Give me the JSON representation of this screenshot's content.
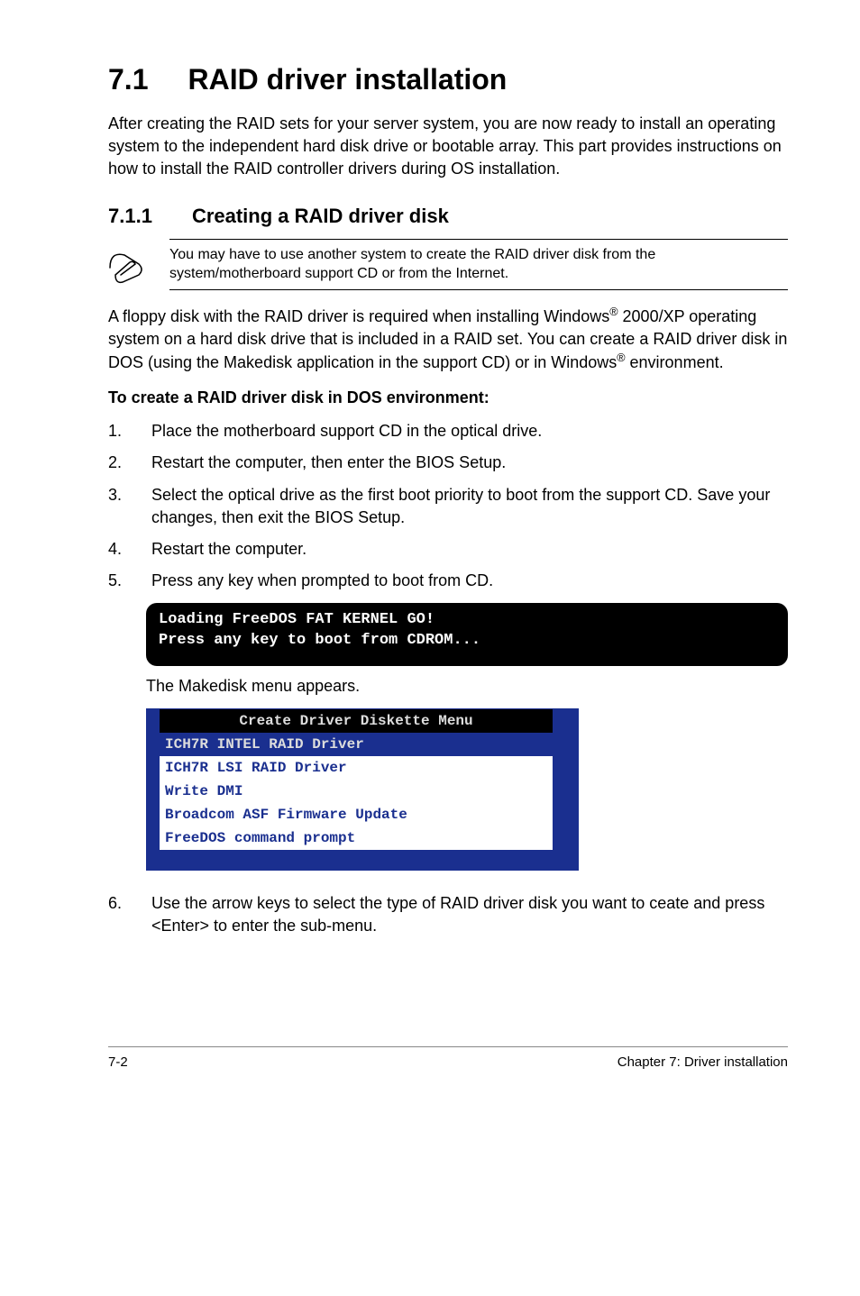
{
  "heading": {
    "number": "7.1",
    "title": "RAID driver installation"
  },
  "intro": "After creating the RAID sets for your server system, you are now ready to install an operating system to the independent hard disk drive or bootable array. This part provides instructions on how to install the RAID controller drivers during OS installation.",
  "subheading": {
    "number": "7.1.1",
    "title": "Creating a RAID driver disk"
  },
  "note": "You may have to use another system to create the RAID driver disk from the system/motherboard support CD or from the Internet.",
  "body_para": {
    "p1a": "A floppy disk with the RAID driver is required when installing Windows",
    "p1b": " 2000/XP operating system on a hard disk drive that is included in a RAID set. You can create a RAID driver disk in DOS (using the Makedisk application in the support CD) or in Windows",
    "p1c": " environment."
  },
  "dos_heading": "To create a RAID driver disk in DOS environment:",
  "steps": [
    "Place the motherboard support CD in the optical drive.",
    "Restart the computer, then enter the BIOS Setup.",
    "Select the optical drive as the first boot priority to boot from the support CD. Save your changes, then exit the BIOS Setup.",
    "Restart the computer.",
    "Press any key when prompted to boot from CD."
  ],
  "terminal": "Loading FreeDOS FAT KERNEL GO!\nPress any key to boot from CDROM...",
  "mid_text": "The Makedisk menu appears.",
  "menu": {
    "title": "Create Driver Diskette Menu",
    "items": [
      "ICH7R INTEL RAID Driver",
      "ICH7R LSI RAID Driver",
      "Write DMI",
      "Broadcom ASF Firmware Update",
      "FreeDOS command prompt"
    ],
    "selected_index": 0
  },
  "step6": "Use the arrow keys to select the type of RAID driver disk you want to ceate and press <Enter> to enter the sub-menu.",
  "footer": {
    "left": "7-2",
    "right": "Chapter 7: Driver installation"
  }
}
